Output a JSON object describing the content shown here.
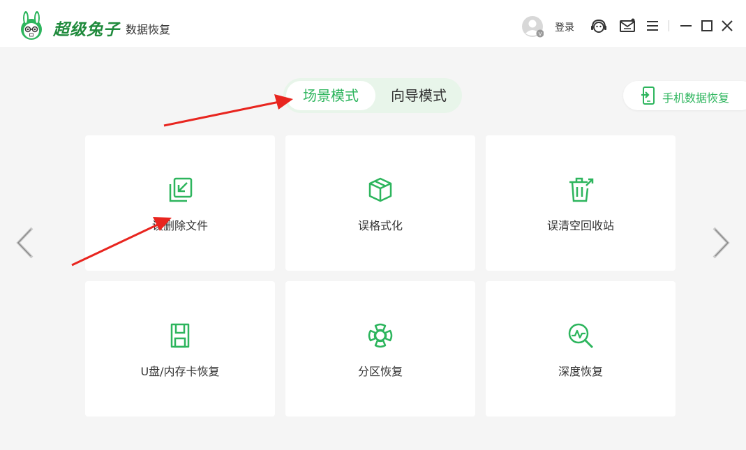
{
  "titlebar": {
    "brand": "超级兔子",
    "brand_sub": "数据恢复",
    "login": "登录",
    "avatar_badge": "V",
    "icons": [
      "avatar-icon",
      "customer-service-icon",
      "message-icon",
      "menu-icon",
      "minimize-icon",
      "maximize-icon",
      "close-icon"
    ]
  },
  "mode_tabs": {
    "active": "场景模式",
    "inactive": "向导模式"
  },
  "phone_button": {
    "label": "手机数据恢复",
    "icon": "phone-transfer-icon"
  },
  "cards": [
    {
      "label": "误删除文件",
      "icon": "deleted-file-icon"
    },
    {
      "label": "误格式化",
      "icon": "format-cube-icon"
    },
    {
      "label": "误清空回收站",
      "icon": "recycle-bin-icon"
    },
    {
      "label": "U盘/内存卡恢复",
      "icon": "sd-card-icon"
    },
    {
      "label": "分区恢复",
      "icon": "partition-icon"
    },
    {
      "label": "深度恢复",
      "icon": "deep-scan-icon"
    }
  ],
  "nav": {
    "prev_icon": "chevron-left-icon",
    "next_icon": "chevron-right-icon"
  },
  "colors": {
    "accent": "#2db55d",
    "brand": "#1f8a3c",
    "annotation": "#e8251f",
    "background": "#f5f5f5"
  }
}
